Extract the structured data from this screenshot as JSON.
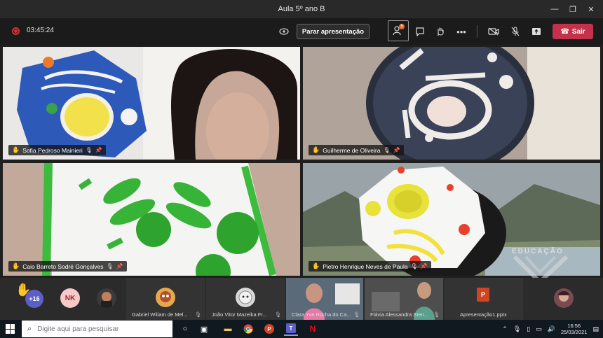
{
  "window": {
    "title": "Aula 5º ano B"
  },
  "toolbar": {
    "timer": "03:45:24",
    "stop_presenting_label": "Parar apresentação",
    "participants_badge": "5",
    "leave_label": "Sair"
  },
  "grid": [
    {
      "name": "Sofia Pedroso Mainieri"
    },
    {
      "name": "Guilherme de Oliveira"
    },
    {
      "name": "Caio Barreto Sodré Gonçalves"
    },
    {
      "name": "Pietro Henrique Neves de Paula"
    }
  ],
  "strip": {
    "more_count": "+16",
    "initials": "NK",
    "participants": [
      {
        "name": "Gabriel Wiliam de Mel..."
      },
      {
        "name": "João Vitor Mazeika Fr..."
      },
      {
        "name": "Clara Yve Rocha do Ca..."
      },
      {
        "name": "Flávia Alessandra Sten..."
      },
      {
        "name": "Apresentação1.pptx"
      }
    ]
  },
  "watermark": {
    "text": "EDUCAÇÃO"
  },
  "taskbar": {
    "search_placeholder": "Digite aqui para pesquisar",
    "time": "16:56",
    "date": "25/03/2021"
  },
  "colors": {
    "accent": "#5b5fc7",
    "leave": "#c4314b",
    "record": "#d13438",
    "raise_hand": "#f2c029"
  }
}
